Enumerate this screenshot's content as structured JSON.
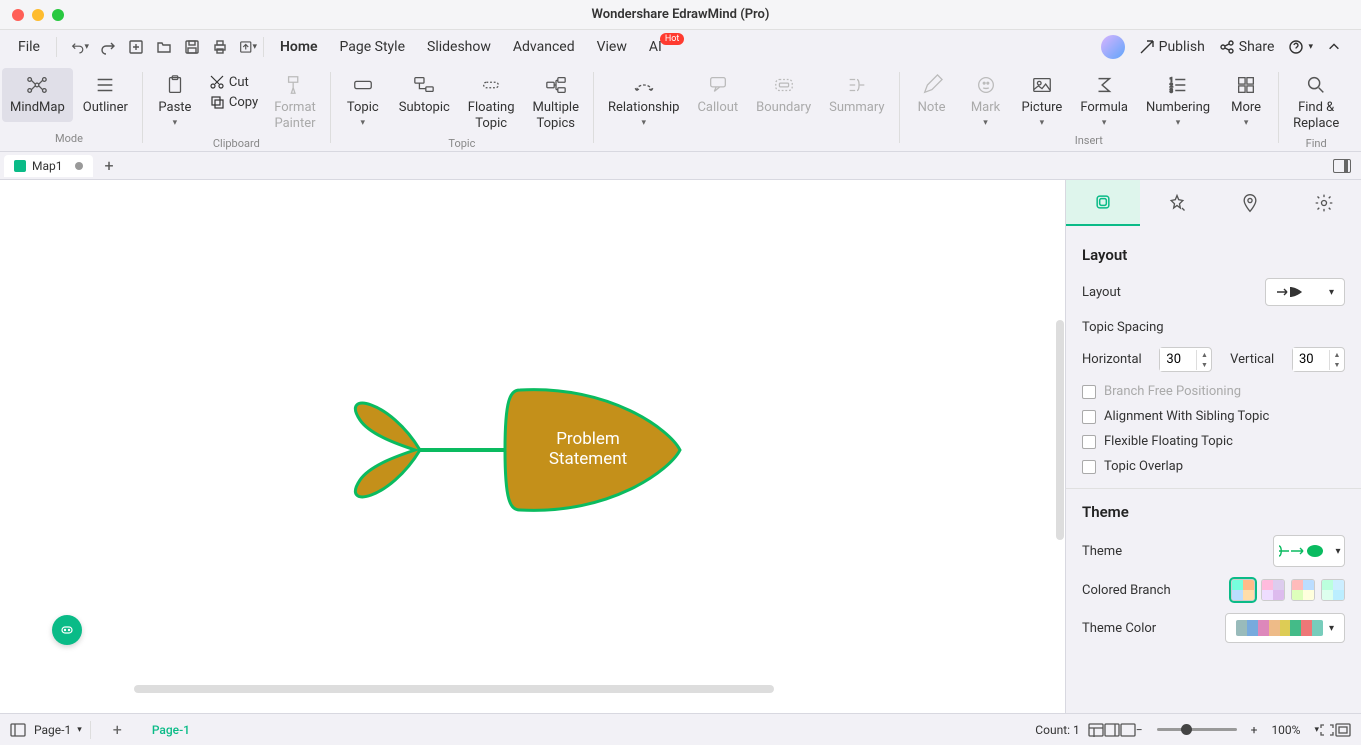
{
  "title": "Wondershare EdrawMind (Pro)",
  "menu": {
    "file": "File",
    "home": "Home",
    "page_style": "Page Style",
    "slideshow": "Slideshow",
    "advanced": "Advanced",
    "view": "View",
    "ai": "AI",
    "hot": "Hot",
    "publish": "Publish",
    "share": "Share"
  },
  "ribbon": {
    "mode": {
      "mindmap": "MindMap",
      "outliner": "Outliner",
      "group": "Mode"
    },
    "clipboard": {
      "paste": "Paste",
      "cut": "Cut",
      "copy": "Copy",
      "format_painter": "Format\nPainter",
      "group": "Clipboard"
    },
    "topic": {
      "topic": "Topic",
      "subtopic": "Subtopic",
      "floating": "Floating\nTopic",
      "multiple": "Multiple\nTopics",
      "group": "Topic"
    },
    "rel": {
      "relationship": "Relationship",
      "callout": "Callout",
      "boundary": "Boundary",
      "summary": "Summary"
    },
    "insert": {
      "note": "Note",
      "mark": "Mark",
      "picture": "Picture",
      "formula": "Formula",
      "numbering": "Numbering",
      "more": "More",
      "group": "Insert"
    },
    "find": {
      "find_replace": "Find &\nReplace",
      "group": "Find"
    }
  },
  "tabs": {
    "map1": "Map1"
  },
  "canvas": {
    "node_text": "Problem\nStatement"
  },
  "panel": {
    "layout_title": "Layout",
    "layout_label": "Layout",
    "topic_spacing": "Topic Spacing",
    "horizontal": "Horizontal",
    "vertical": "Vertical",
    "h_val": "30",
    "v_val": "30",
    "branch_free": "Branch Free Positioning",
    "align_sibling": "Alignment With Sibling Topic",
    "flex_float": "Flexible Floating Topic",
    "topic_overlap": "Topic Overlap",
    "theme_title": "Theme",
    "theme_label": "Theme",
    "colored_branch": "Colored Branch",
    "theme_color": "Theme Color"
  },
  "status": {
    "page_dropdown": "Page-1",
    "page_tab": "Page-1",
    "count": "Count: 1",
    "zoom": "100%"
  }
}
